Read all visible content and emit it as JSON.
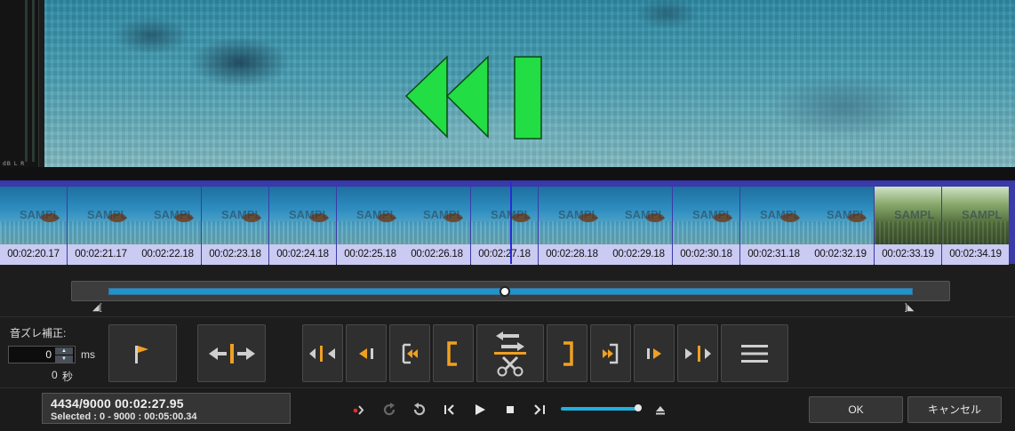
{
  "thumbnails": [
    {
      "time": "00:02:20.17",
      "watermark": "SAMPL",
      "scene": "sea"
    },
    {
      "time": "00:02:21.17",
      "watermark": "SAMPL",
      "scene": "sea"
    },
    {
      "time": "00:02:22.18",
      "watermark": "SAMPL",
      "scene": "sea"
    },
    {
      "time": "00:02:23.18",
      "watermark": "SAMPL",
      "scene": "sea"
    },
    {
      "time": "00:02:24.18",
      "watermark": "SAMPL",
      "scene": "sea"
    },
    {
      "time": "00:02:25.18",
      "watermark": "SAMPL",
      "scene": "sea"
    },
    {
      "time": "00:02:26.18",
      "watermark": "SAMPL",
      "scene": "sea"
    },
    {
      "time": "00:02:27.18",
      "watermark": "SAMPL",
      "scene": "sea"
    },
    {
      "time": "00:02:28.18",
      "watermark": "SAMPL",
      "scene": "sea"
    },
    {
      "time": "00:02:29.18",
      "watermark": "SAMPL",
      "scene": "sea"
    },
    {
      "time": "00:02:30.18",
      "watermark": "SAMPL",
      "scene": "sea"
    },
    {
      "time": "00:02:31.18",
      "watermark": "SAMPL",
      "scene": "sea"
    },
    {
      "time": "00:02:32.19",
      "watermark": "SAMPL",
      "scene": "sea"
    },
    {
      "time": "00:02:33.19",
      "watermark": "SAMPL",
      "scene": "grass"
    },
    {
      "time": "00:02:34.19",
      "watermark": "SAMPL",
      "scene": "grass"
    }
  ],
  "audio_offset": {
    "label": "音ズレ補正:",
    "value": "0",
    "unit": "ms",
    "seconds_value": "0",
    "seconds_unit": "秒"
  },
  "level_meter": {
    "labels": "dB L R"
  },
  "status": {
    "frame_time": "4434/9000  00:02:27.95",
    "selected": "Selected : 0 - 9000 : 00:05:00.34"
  },
  "buttons": {
    "ok": "OK",
    "cancel": "キャンセル"
  },
  "range": {
    "start_mark": "◢[",
    "end_mark": "]◣"
  },
  "colors": {
    "accent_orange": "#f0a020",
    "overlay_green": "#22dd44",
    "thumb_strip": "#3a3aa8",
    "range_fill": "#1e94c8"
  }
}
